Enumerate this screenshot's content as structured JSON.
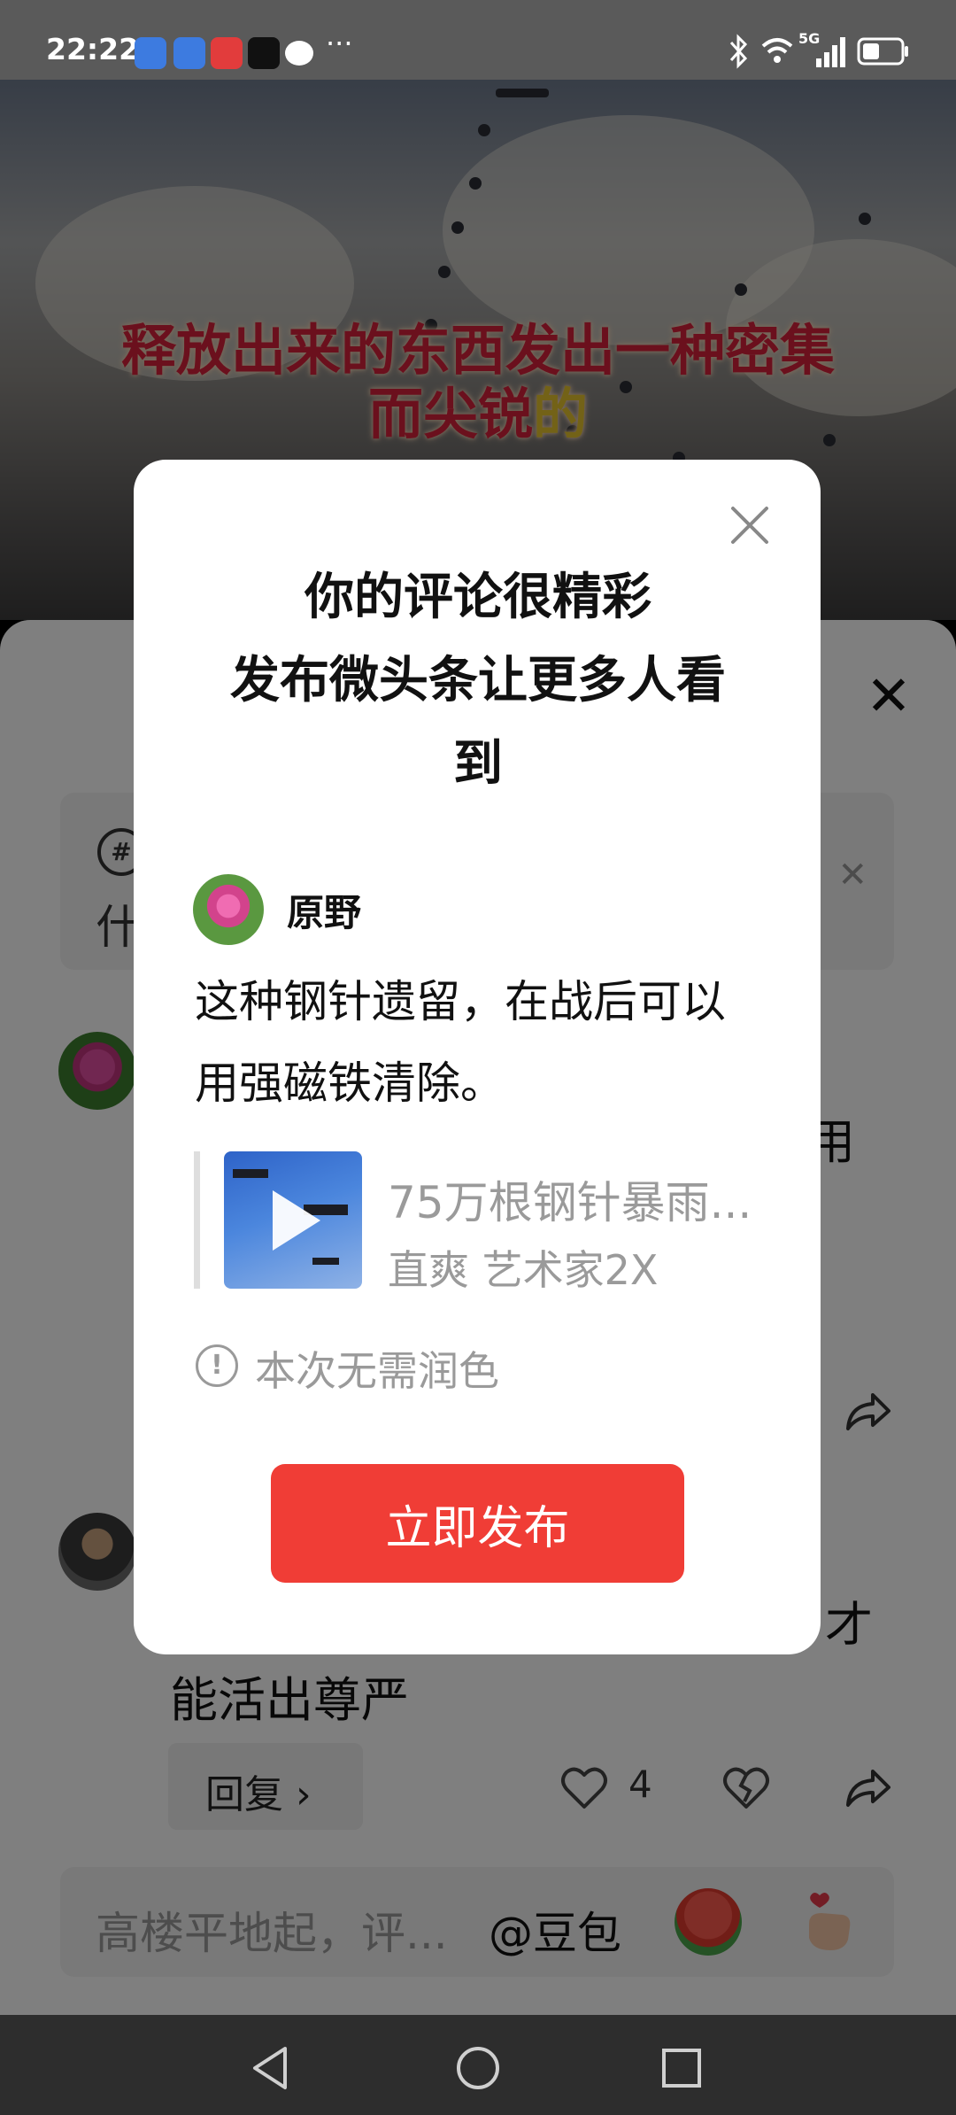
{
  "status_bar": {
    "time": "22:22",
    "app_icons": [
      "browser-icon",
      "browser-icon",
      "toutiao-icon",
      "tiktok-icon",
      "message-icon"
    ],
    "more": "···",
    "network": "5G",
    "icons_right": [
      "bluetooth-icon",
      "wifi-icon",
      "signal-icon",
      "battery-icon"
    ]
  },
  "video": {
    "subtitle_line1": "释放出来的东西发出一种密集",
    "subtitle_line2_main": "而尖锐",
    "subtitle_line2_highlight": "的"
  },
  "comment_sheet": {
    "topic_text": "什",
    "comment1_tail": "用",
    "comment2_tail": "才",
    "comment2_line2": "能活出尊严",
    "reply_label": "回复 ›",
    "like_count": "4",
    "input_placeholder": "高楼平地起，评...",
    "mention": "@豆包"
  },
  "dialog": {
    "title": "你的评论很精彩\n发布微头条让更多人看\n到",
    "username": "原野",
    "comment": "这种钢针遗留，在战后可以用强磁铁清除。",
    "video_title": "75万根钢针暴雨...",
    "video_author": "直爽 艺术家2X",
    "info_text": "本次无需润色",
    "publish_label": "立即发布"
  },
  "colors": {
    "publish_button": "#f03d36",
    "subtitle_red": "#d7203a",
    "subtitle_yellow": "#e6c42f"
  }
}
